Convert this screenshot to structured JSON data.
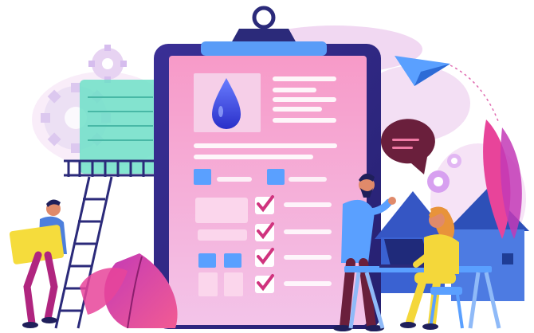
{
  "illustration": {
    "subject": "clipboard-checklist-teamwork",
    "icons": [
      "water-drop-icon",
      "paper-plane-icon",
      "speech-bubble-icon",
      "gear-icon",
      "checkmark-icon",
      "house-icon",
      "leaf-icon",
      "ladder-icon",
      "laptop-icon"
    ],
    "checklist_checked": [
      true,
      true,
      true,
      true
    ],
    "colors": {
      "clipboard_frame": "#2b2f8f",
      "paper": "#f7b6d8",
      "accent_blue": "#5aa0ff",
      "drop": "#4f5ee8",
      "pink_leaf": "#e8449a",
      "teal_panel": "#57d6c4",
      "house_blue": "#2d6bd6",
      "yellow": "#f4d73a",
      "background_cloud": "#f1d8f2"
    }
  }
}
